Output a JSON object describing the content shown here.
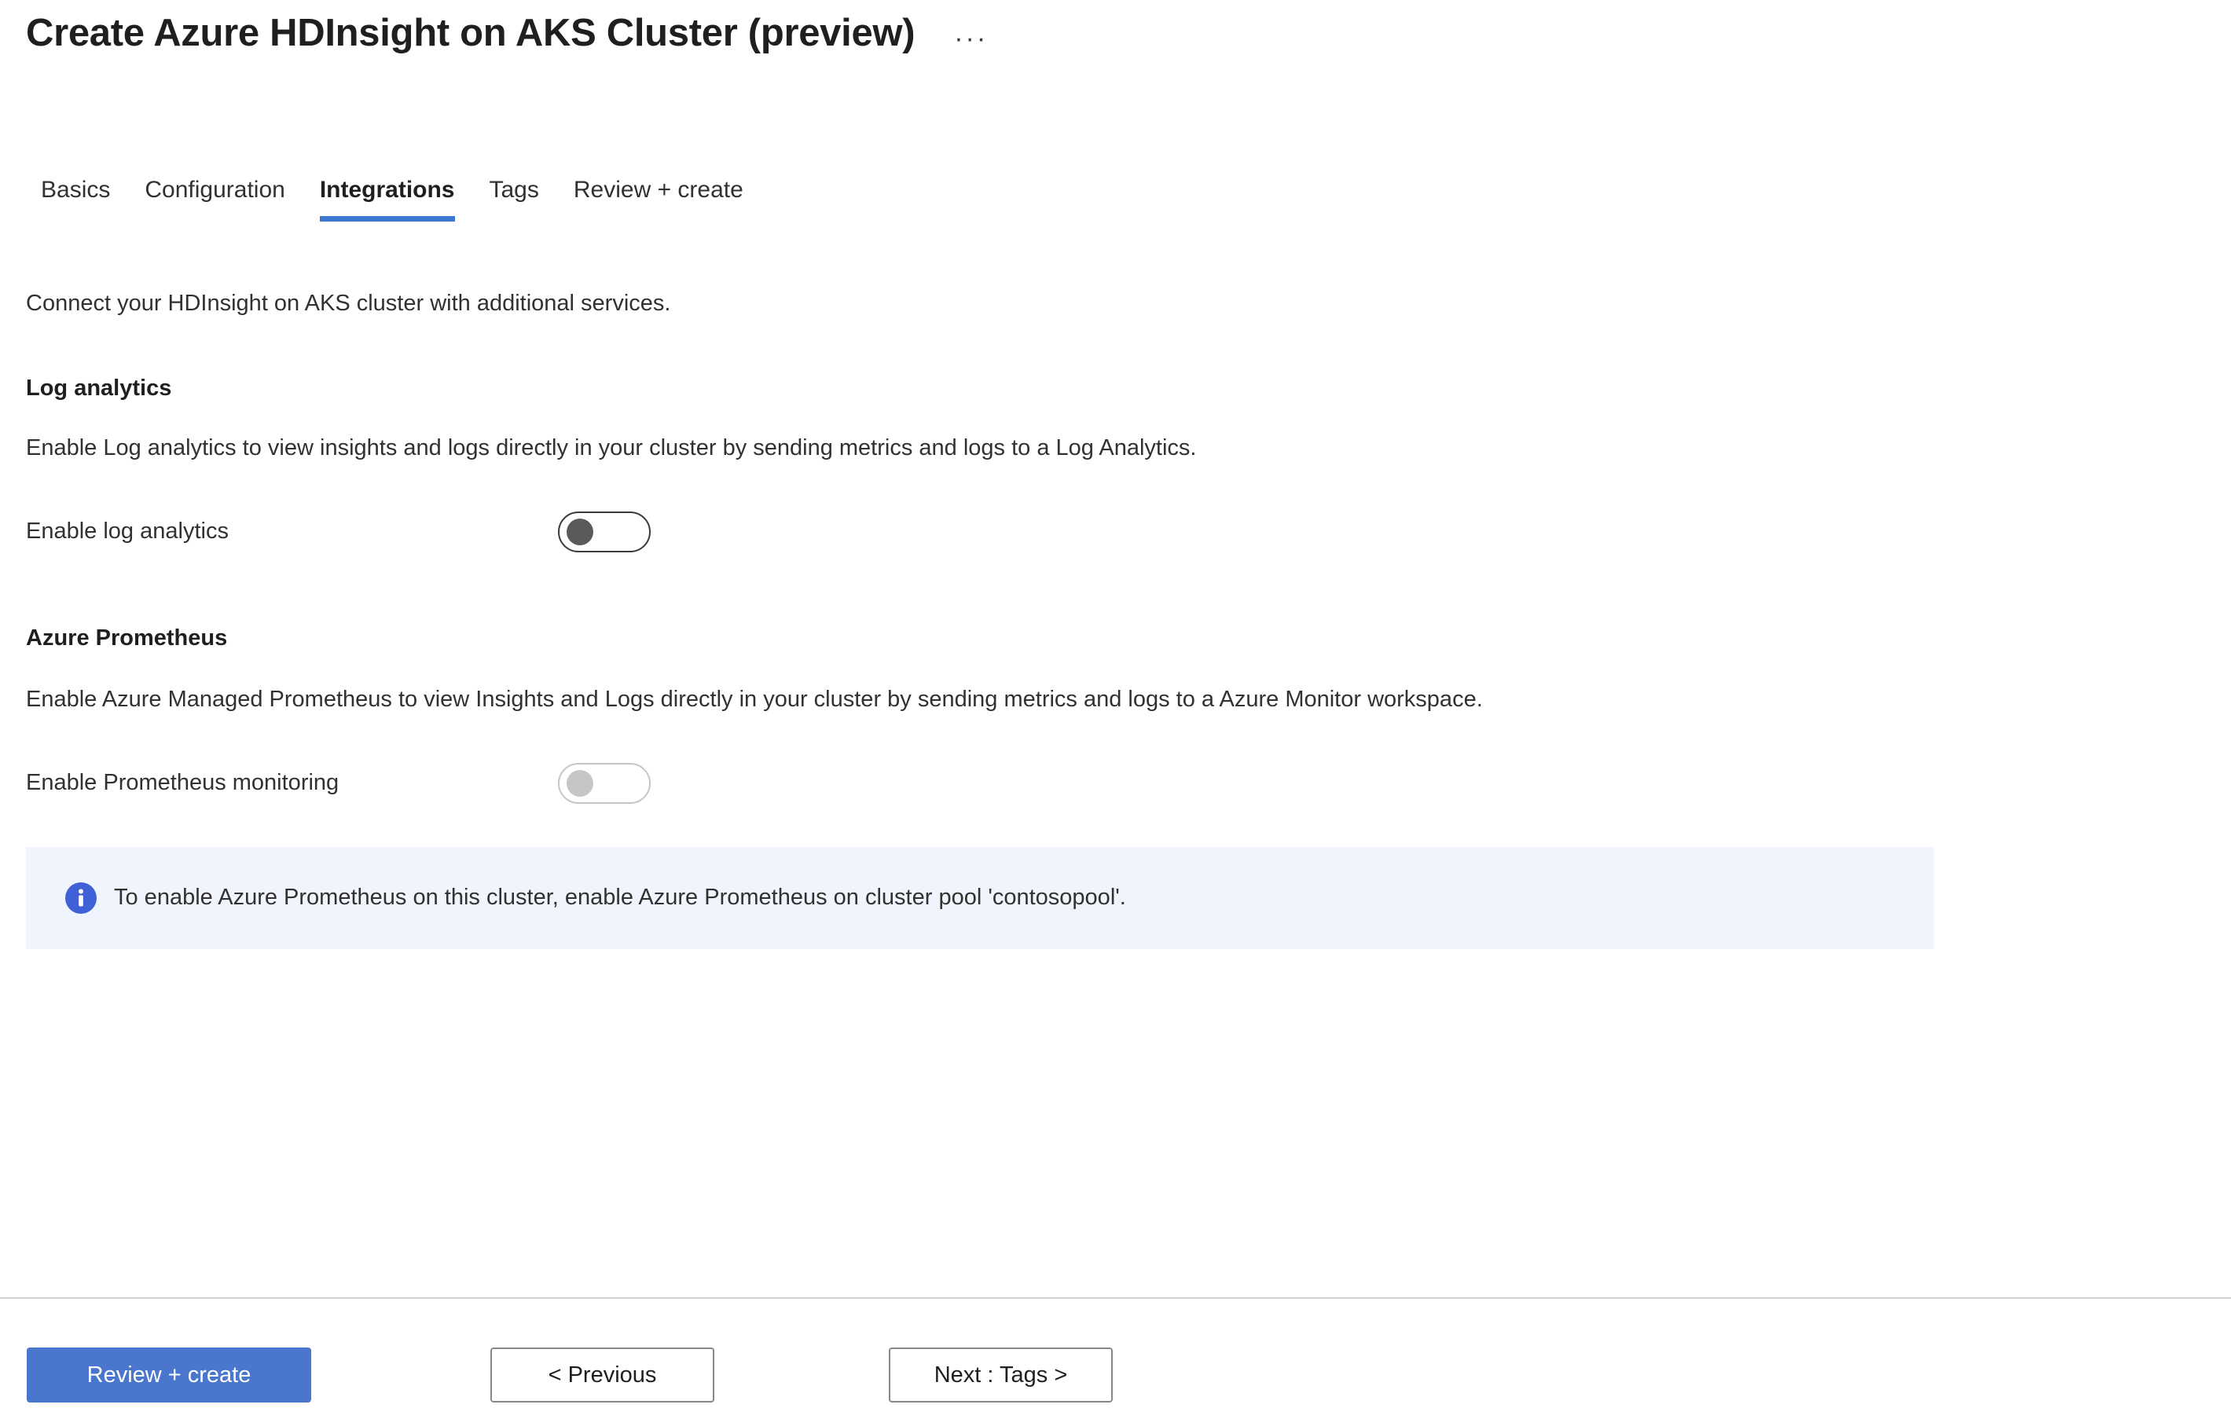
{
  "header": {
    "title": "Create Azure HDInsight on AKS Cluster (preview)",
    "ellipsis": "···",
    "ellipsis_name": "more-options-icon"
  },
  "tabs": [
    {
      "label": "Basics",
      "active": false
    },
    {
      "label": "Configuration",
      "active": false
    },
    {
      "label": "Integrations",
      "active": true
    },
    {
      "label": "Tags",
      "active": false
    },
    {
      "label": "Review + create",
      "active": false
    }
  ],
  "main": {
    "intro": "Connect your HDInsight on AKS cluster with additional services.",
    "sections": [
      {
        "title": "Log analytics",
        "description": "Enable Log analytics to view insights and logs directly in your cluster by sending metrics and logs to a Log Analytics.",
        "field_label": "Enable log analytics",
        "toggle_state": "off",
        "toggle_enabled": true
      },
      {
        "title": "Azure Prometheus",
        "description": "Enable Azure Managed Prometheus to view Insights and Logs directly in your cluster by sending metrics and logs to a Azure Monitor workspace.",
        "field_label": "Enable Prometheus monitoring",
        "toggle_state": "off",
        "toggle_enabled": false
      }
    ],
    "info_banner": {
      "icon": "info-circle-icon",
      "text": "To enable Azure Prometheus on this cluster, enable Azure Prometheus on cluster pool 'contosopool'."
    }
  },
  "footer": {
    "review_create": "Review + create",
    "previous": "< Previous",
    "next": "Next : Tags >"
  },
  "colors": {
    "accent_blue": "#4a76cd",
    "tab_underline": "#3c78ce",
    "info_banner_bg": "#eff4fd",
    "info_icon": "#4060d8",
    "text": "#323130",
    "border": "#8a8886"
  }
}
